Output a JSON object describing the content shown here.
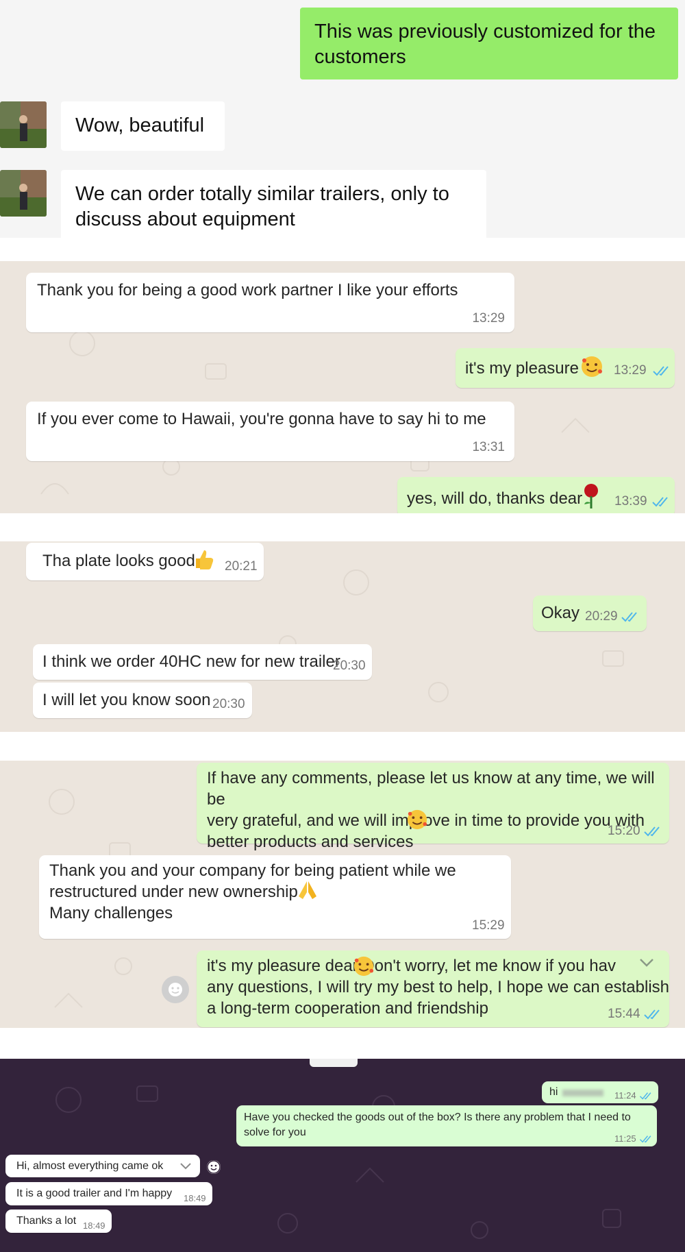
{
  "panel1": {
    "out1": "This was previously customized for the\ncustomers",
    "in1": "Wow, beautiful",
    "in2": "We can order totally similar trailers, only to\ndiscuss about equipment"
  },
  "panel2": {
    "in1": {
      "text": "Thank you for being a good work partner I like your efforts",
      "time": "13:29"
    },
    "out1": {
      "text": "it's my pleasure",
      "time": "13:29"
    },
    "in2": {
      "text": "If you ever come to Hawaii, you're gonna have to say hi to me",
      "time": "13:31"
    },
    "out2": {
      "text": "yes, will do, thanks dear",
      "time": "13:39"
    }
  },
  "panel3": {
    "in1": {
      "text": "Tha plate looks good",
      "time": "20:21"
    },
    "out1": {
      "text": "Okay",
      "time": "20:29"
    },
    "in2": {
      "text": "I think we order 40HC new for new trailer",
      "time": "20:30"
    },
    "in3": {
      "text": "I will let you know soon",
      "time": "20:30"
    }
  },
  "panel4": {
    "out1": {
      "text": "If have any comments, please let us know at any time, we will be\nvery grateful, and we will improve in time to provide you with\nbetter products and services",
      "time": "15:20"
    },
    "in1": {
      "text": "Thank you and your company for being patient while we\nrestructured under new ownership \nMany challenges",
      "time": "15:29"
    },
    "out2": {
      "text": "it's my pleasure dear   Don't worry, let me know if you hav\nany questions, I will try my best to help, I hope we can establish\na long-term cooperation and friendship",
      "time": "15:44"
    }
  },
  "panel5": {
    "out1": {
      "text": "hi",
      "time": "11:24"
    },
    "out2": {
      "text": "Have you checked the goods out of the box? Is there any problem that I need to\nsolve for you",
      "time": "11:25"
    },
    "in1": {
      "text": "Hi, almost everything came ok"
    },
    "in2": {
      "text": "It is a good trailer and I'm happy",
      "time": "18:49"
    },
    "in3": {
      "text": "Thanks a lot",
      "time": "18:49"
    }
  },
  "colors": {
    "wechat_green": "#95ec69",
    "whatsapp_out": "#dcf8c6",
    "whatsapp_bg": "#ece5dd",
    "tick_blue": "#4fb6ec",
    "dark_bg": "#33233b"
  }
}
